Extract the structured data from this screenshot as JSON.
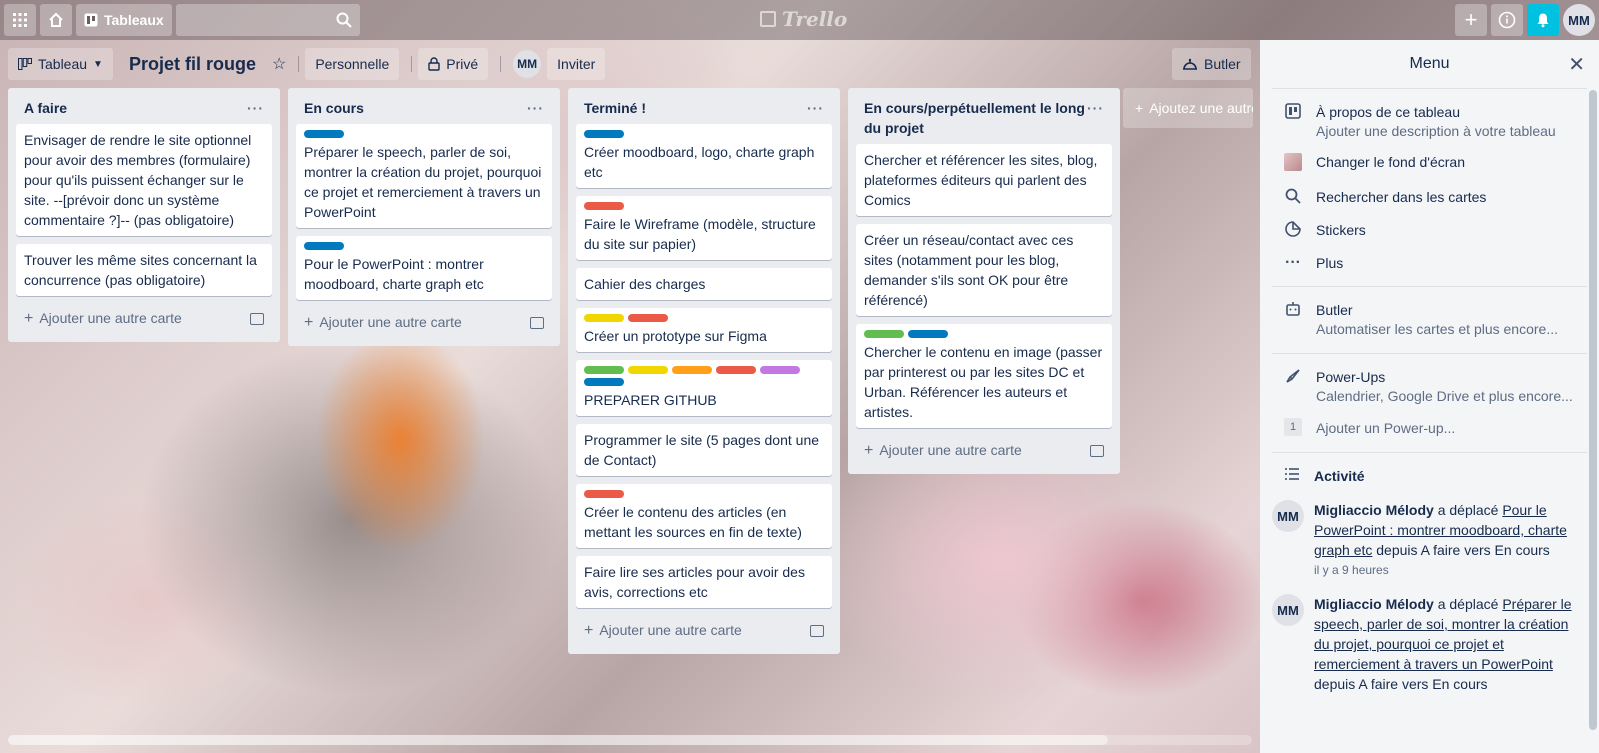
{
  "topbar": {
    "boards_label": "Tableaux",
    "logo_text": "Trello",
    "user_initials": "MM"
  },
  "board_header": {
    "view_label": "Tableau",
    "title": "Projet fil rouge",
    "workspace": "Personnelle",
    "visibility": "Privé",
    "member_initials": "MM",
    "invite_label": "Inviter",
    "butler_label": "Butler"
  },
  "label_colors": {
    "blue": "#0079bf",
    "red": "#eb5a46",
    "yellow": "#f2d600",
    "green": "#61bd4f",
    "orange": "#ff9f1a",
    "purple": "#c377e0"
  },
  "lists": [
    {
      "title": "A faire",
      "add_label": "Ajouter une autre carte",
      "cards": [
        {
          "labels": [],
          "text": "Envisager de rendre le site optionnel pour avoir des membres (formulaire) pour qu'ils puissent échanger sur le site. --[prévoir donc un système commentaire ?]-- (pas obligatoire)"
        },
        {
          "labels": [],
          "text": "Trouver les même sites concernant la concurrence (pas obligatoire)"
        }
      ]
    },
    {
      "title": "En cours",
      "add_label": "Ajouter une autre carte",
      "cards": [
        {
          "labels": [
            "blue"
          ],
          "text": "Préparer le speech, parler de soi, montrer la création du projet, pourquoi ce projet et remerciement à travers un PowerPoint"
        },
        {
          "labels": [
            "blue"
          ],
          "text": "Pour le PowerPoint : montrer moodboard, charte graph etc"
        }
      ]
    },
    {
      "title": "Terminé !",
      "add_label": "Ajouter une autre carte",
      "cards": [
        {
          "labels": [
            "blue"
          ],
          "text": "Créer moodboard, logo, charte graph etc"
        },
        {
          "labels": [
            "red"
          ],
          "text": "Faire le Wireframe (modèle, structure du site sur papier)"
        },
        {
          "labels": [],
          "text": "Cahier des charges"
        },
        {
          "labels": [
            "yellow",
            "red"
          ],
          "text": "Créer un prototype sur Figma"
        },
        {
          "labels": [
            "green",
            "yellow",
            "orange",
            "red",
            "purple",
            "blue"
          ],
          "text": "PREPARER GITHUB"
        },
        {
          "labels": [],
          "text": "Programmer le site (5 pages dont une de Contact)"
        },
        {
          "labels": [
            "red"
          ],
          "text": "Créer le contenu des articles (en mettant les sources en fin de texte)"
        },
        {
          "labels": [],
          "text": "Faire lire ses articles pour avoir des avis, corrections etc"
        }
      ]
    },
    {
      "title": "En cours/perpétuellement le long du projet",
      "add_label": "Ajouter une autre carte",
      "cards": [
        {
          "labels": [],
          "text": "Chercher et référencer les sites, blog, plateformes éditeurs qui parlent des Comics"
        },
        {
          "labels": [],
          "text": "Créer un réseau/contact avec ces sites (notamment pour les blog, demander s'ils sont OK pour être référencé)"
        },
        {
          "labels": [
            "green",
            "blue"
          ],
          "text": "Chercher le contenu en image (passer par printerest ou par les sites DC et Urban. Référencer les auteurs et artistes."
        }
      ]
    }
  ],
  "add_list_label": "Ajoutez une autre liste",
  "menu": {
    "title": "Menu",
    "about_title": "À propos de ce tableau",
    "about_desc": "Ajouter une description à votre tableau",
    "change_bg": "Changer le fond d'écran",
    "search_cards": "Rechercher dans les cartes",
    "stickers": "Stickers",
    "more": "Plus",
    "butler_title": "Butler",
    "butler_desc": "Automatiser les cartes et plus encore...",
    "powerups_title": "Power-Ups",
    "powerups_desc": "Calendrier, Google Drive et plus encore...",
    "powerup_count": "1",
    "add_powerup": "Ajouter un Power-up...",
    "activity_title": "Activité",
    "activities": [
      {
        "initials": "MM",
        "user": "Migliaccio Mélody",
        "verb": "a déplacé",
        "card": "Pour le PowerPoint : montrer moodboard, charte graph etc",
        "detail": "depuis A faire vers En cours",
        "time": "il y a 9 heures"
      },
      {
        "initials": "MM",
        "user": "Migliaccio Mélody",
        "verb": "a déplacé",
        "card": "Préparer le speech, parler de soi, montrer la création du projet, pourquoi ce projet et remerciement à travers un PowerPoint",
        "detail": "depuis A faire vers En cours",
        "time": ""
      }
    ]
  }
}
